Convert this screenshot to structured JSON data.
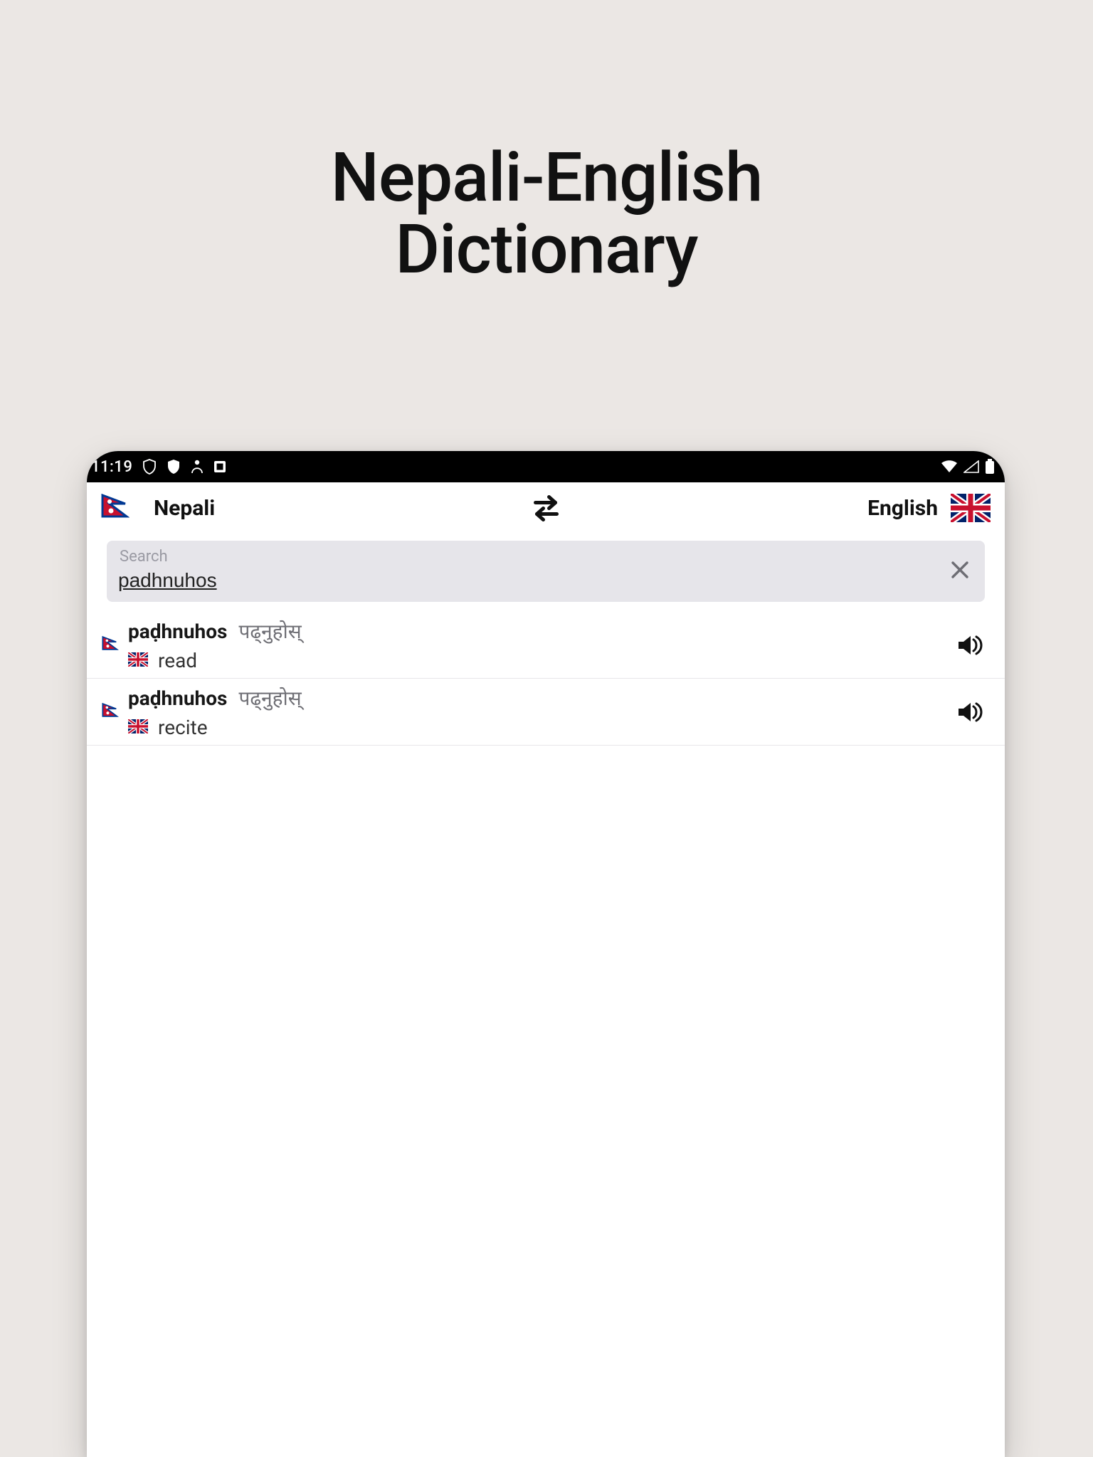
{
  "pageTitle": {
    "line1": "Nepali-English",
    "line2": "Dictionary"
  },
  "statusbar": {
    "time": "11:19"
  },
  "languages": {
    "left": {
      "label": "Nepali"
    },
    "right": {
      "label": "English"
    }
  },
  "search": {
    "label": "Search",
    "value": "padhnuhos"
  },
  "results": [
    {
      "transliteration": "paḍhnuhos",
      "devanagari": "पढ्नुहोस्",
      "english": "read"
    },
    {
      "transliteration": "paḍhnuhos",
      "devanagari": "पढ्नुहोस्",
      "english": "recite"
    }
  ]
}
